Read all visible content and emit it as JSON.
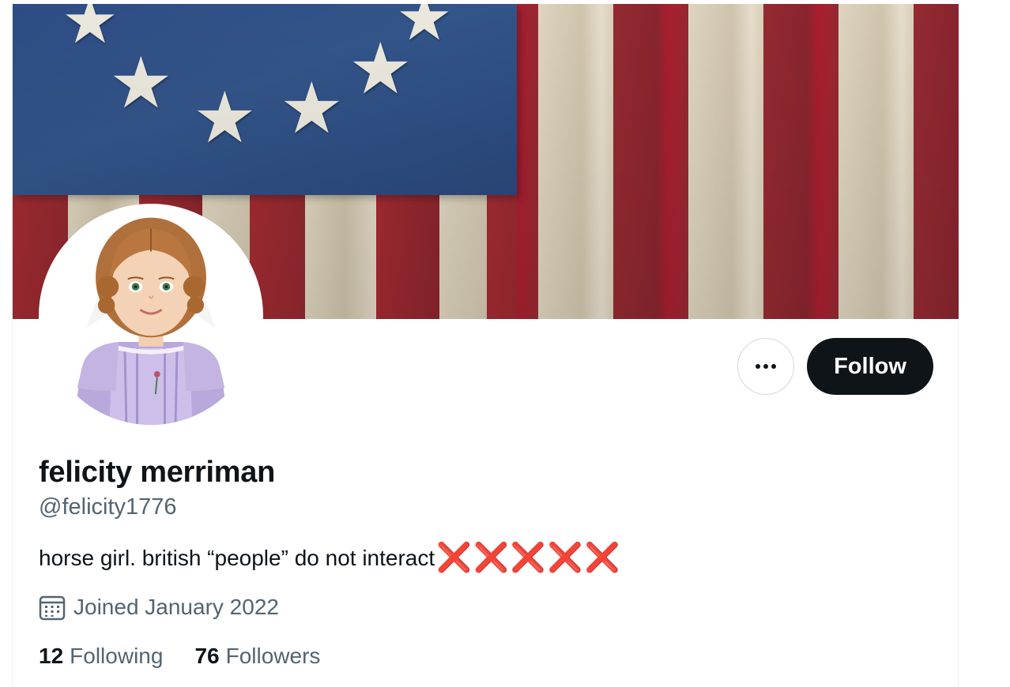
{
  "profile": {
    "display_name": "felicity merriman",
    "handle": "@felicity1776",
    "bio_text": "horse girl. british “people” do not interact",
    "bio_emojis": "❌❌❌❌❌",
    "joined": "Joined January 2022",
    "following_count": "12",
    "following_label": "Following",
    "followers_count": "76",
    "followers_label": "Followers"
  },
  "actions": {
    "follow_label": "Follow",
    "more_icon": "more-horizontal-icon"
  },
  "icons": {
    "calendar": "calendar-icon"
  },
  "colors": {
    "follow_bg": "#0f1419",
    "secondary_text": "#536471",
    "cross_red": "#d8323f"
  }
}
